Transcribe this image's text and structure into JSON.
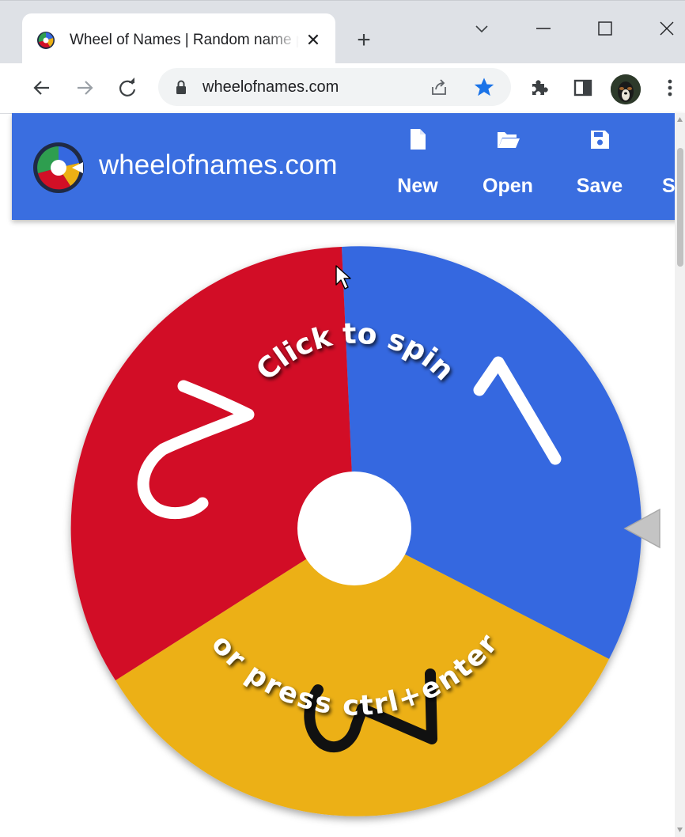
{
  "browser": {
    "tab_title": "Wheel of Names | Random name picker",
    "url": "wheelofnames.com",
    "icons": [
      "favicon-icon",
      "close-icon",
      "plus-icon",
      "chevron-down-icon",
      "minimize-icon",
      "maximize-icon",
      "close-window-icon",
      "back-arrow-icon",
      "forward-arrow-icon",
      "reload-icon",
      "lock-icon",
      "share-icon",
      "star-icon",
      "extensions-icon",
      "side-panel-icon",
      "more-vertical-icon"
    ]
  },
  "app": {
    "brand": "wheelofnames.com",
    "buttons": {
      "new": "New",
      "open": "Open",
      "save": "Save",
      "share": "S"
    }
  },
  "wheel": {
    "top_text": "Click to spin",
    "bottom_text": "or press ctrl+enter",
    "segments": [
      {
        "label": "1",
        "color": "#3568e0"
      },
      {
        "label": "3",
        "color": "#ecb014"
      },
      {
        "label": "2",
        "color": "#d20f26"
      }
    ],
    "pointer_color": "#c4c4c4"
  },
  "colors": {
    "accent": "#3a6ee0",
    "star": "#1a73e8"
  }
}
